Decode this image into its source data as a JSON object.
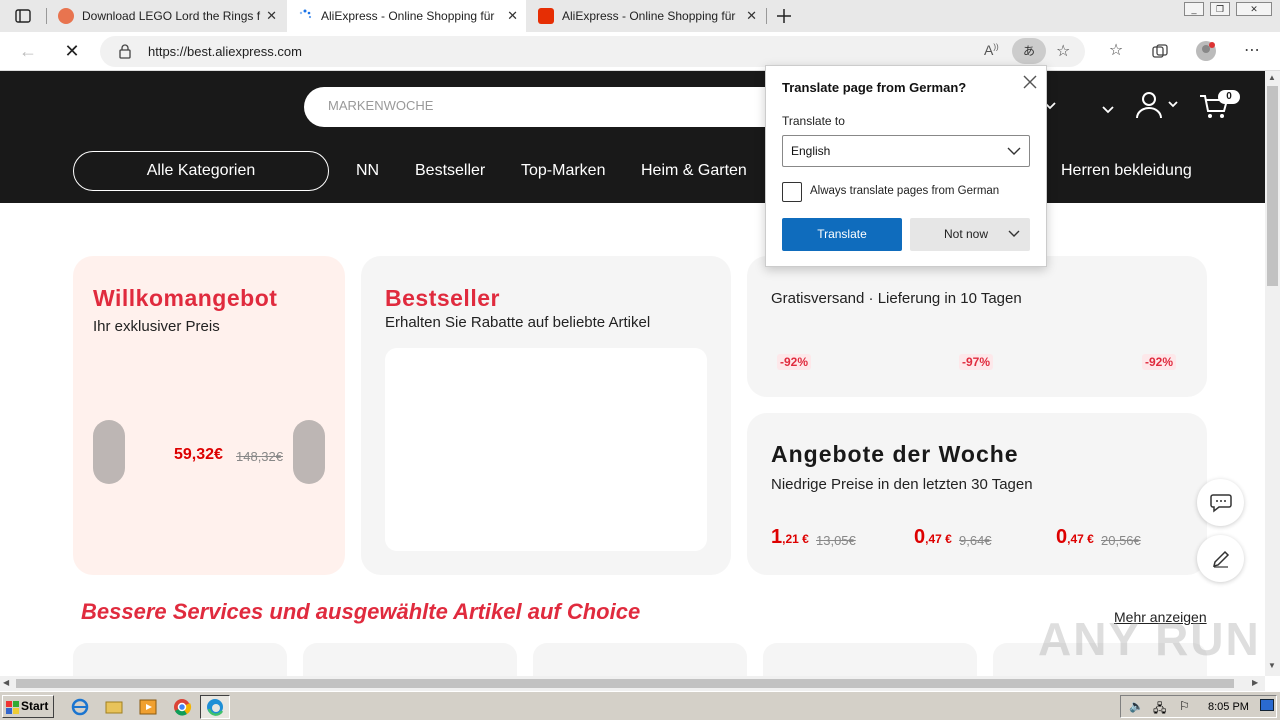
{
  "browser": {
    "tabs": [
      {
        "title": "Download LEGO Lord the Rings f"
      },
      {
        "title": "AliExpress - Online Shopping für"
      },
      {
        "title": "AliExpress - Online Shopping für"
      }
    ],
    "url": "https://best.aliexpress.com"
  },
  "site": {
    "search_placeholder": "MARKENWOCHE",
    "cart_count": "0",
    "categories_button": "Alle Kategorien",
    "nav": [
      "NN",
      "Bestseller",
      "Top-Marken",
      "Heim & Garten",
      "Herren bekleidung"
    ]
  },
  "cards": {
    "welcome": {
      "title": "Willkomangebot",
      "subtitle": "Ihr exklusiver Preis",
      "price": "59,32€",
      "old_price": "148,32€"
    },
    "bestseller": {
      "title": "Bestseller",
      "subtitle": "Erhalten Sie Rabatte auf beliebte Artikel"
    },
    "shipping": {
      "subtitle": "Gratisversand · Lieferung in 10 Tagen",
      "discounts": [
        "-92%",
        "-97%",
        "-92%"
      ]
    },
    "weekly": {
      "title": "Angebote der Woche",
      "subtitle": "Niedrige Preise in den letzten 30 Tagen",
      "deals": [
        {
          "main": "1",
          "cents": ",21 €",
          "old": "13,05€"
        },
        {
          "main": "0",
          "cents": ",47 €",
          "old": "9,64€"
        },
        {
          "main": "0",
          "cents": ",47 €",
          "old": "20,56€"
        }
      ]
    }
  },
  "choice": {
    "title": "Bessere Services und ausgewählte Artikel auf Choice",
    "more": "Mehr anzeigen"
  },
  "translate_popup": {
    "title": "Translate page from German?",
    "label": "Translate to",
    "selected_language": "English",
    "checkbox_label": "Always translate pages from German",
    "translate_button": "Translate",
    "not_now_button": "Not now"
  },
  "taskbar": {
    "start": "Start",
    "clock": "8:05 PM"
  },
  "watermark": "ANY RUN"
}
